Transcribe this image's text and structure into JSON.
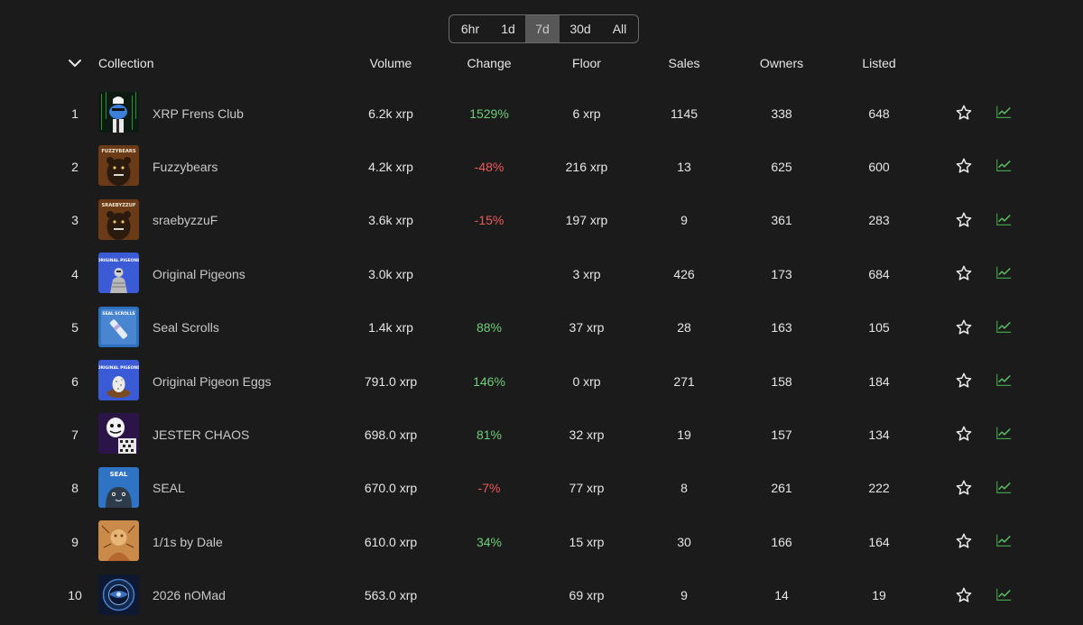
{
  "ranges": [
    "6hr",
    "1d",
    "7d",
    "30d",
    "All"
  ],
  "active_range": "7d",
  "columns": {
    "collection": "Collection",
    "volume": "Volume",
    "change": "Change",
    "floor": "Floor",
    "sales": "Sales",
    "owners": "Owners",
    "listed": "Listed"
  },
  "colors": {
    "background": "#1b1b1b",
    "positive": "#6fcf7a",
    "negative": "#ec5b5b",
    "trend_icon": "#4caf50"
  },
  "rows": [
    {
      "rank": "1",
      "name": "XRP Frens Club",
      "volume": "6.2k xrp",
      "change": "1529%",
      "trend": "up",
      "floor": "6 xrp",
      "sales": "1145",
      "owners": "338",
      "listed": "648",
      "thumb": "frens"
    },
    {
      "rank": "2",
      "name": "Fuzzybears",
      "volume": "4.2k xrp",
      "change": "-48%",
      "trend": "down",
      "floor": "216 xrp",
      "sales": "13",
      "owners": "625",
      "listed": "600",
      "thumb": "bear",
      "thumb_text": "FUZZYBEARS"
    },
    {
      "rank": "3",
      "name": "sraebyzzuF",
      "volume": "3.6k xrp",
      "change": "-15%",
      "trend": "down",
      "floor": "197 xrp",
      "sales": "9",
      "owners": "361",
      "listed": "283",
      "thumb": "bear",
      "thumb_text": "SRAEBYZZUF"
    },
    {
      "rank": "4",
      "name": "Original Pigeons",
      "volume": "3.0k xrp",
      "change": "",
      "trend": "none",
      "floor": "3 xrp",
      "sales": "426",
      "owners": "173",
      "listed": "684",
      "thumb": "pigeon",
      "thumb_text": "ORIGINAL PIGEONS"
    },
    {
      "rank": "5",
      "name": "Seal Scrolls",
      "volume": "1.4k xrp",
      "change": "88%",
      "trend": "up",
      "floor": "37 xrp",
      "sales": "28",
      "owners": "163",
      "listed": "105",
      "thumb": "scroll",
      "thumb_text": "SEAL SCROLLS"
    },
    {
      "rank": "6",
      "name": "Original Pigeon Eggs",
      "volume": "791.0 xrp",
      "change": "146%",
      "trend": "up",
      "floor": "0 xrp",
      "sales": "271",
      "owners": "158",
      "listed": "184",
      "thumb": "egg",
      "thumb_text": "ORIGINAL PIGEONS"
    },
    {
      "rank": "7",
      "name": "JESTER CHAOS",
      "volume": "698.0 xrp",
      "change": "81%",
      "trend": "up",
      "floor": "32 xrp",
      "sales": "19",
      "owners": "157",
      "listed": "134",
      "thumb": "jester"
    },
    {
      "rank": "8",
      "name": "SEAL",
      "volume": "670.0 xrp",
      "change": "-7%",
      "trend": "down",
      "floor": "77 xrp",
      "sales": "8",
      "owners": "261",
      "listed": "222",
      "thumb": "seal",
      "thumb_text": "SEAL"
    },
    {
      "rank": "9",
      "name": "1/1s by Dale",
      "volume": "610.0 xrp",
      "change": "34%",
      "trend": "up",
      "floor": "15 xrp",
      "sales": "30",
      "owners": "166",
      "listed": "164",
      "thumb": "dale"
    },
    {
      "rank": "10",
      "name": "2026 nOMad",
      "volume": "563.0 xrp",
      "change": "",
      "trend": "none",
      "floor": "69 xrp",
      "sales": "9",
      "owners": "14",
      "listed": "19",
      "thumb": "nomad"
    }
  ],
  "icons": {
    "sort_toggle": "chevron-down-icon",
    "favorite": "star-outline-icon",
    "chart": "trend-chart-icon"
  }
}
